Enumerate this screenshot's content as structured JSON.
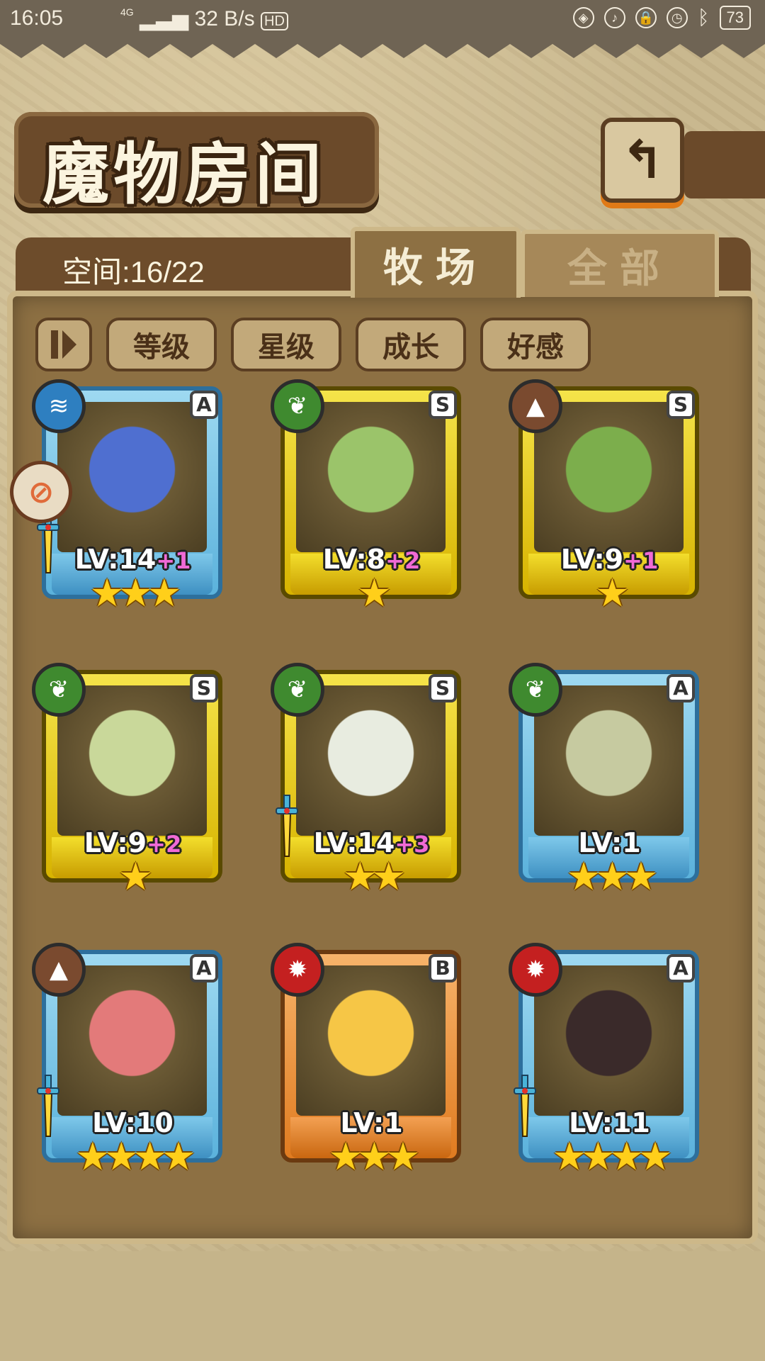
{
  "status_bar": {
    "time": "16:05",
    "network": "4G",
    "speed": "32 B/s",
    "hd": "HD",
    "battery": "73"
  },
  "header": {
    "title": "魔物房间",
    "back_icon": "return-arrow-icon"
  },
  "room": {
    "space_label": "空间:16/22"
  },
  "tabs": [
    {
      "label": "牧场",
      "active": true
    },
    {
      "label": "全部",
      "active": false
    }
  ],
  "sort_buttons": [
    "等级",
    "星级",
    "成长",
    "好感"
  ],
  "monsters": [
    {
      "rank": "A",
      "element": "water",
      "level": "LV:14",
      "bonus": "+1",
      "stars": 3,
      "equipped": true,
      "frame": "A"
    },
    {
      "rank": "S",
      "element": "grass",
      "level": "LV:8",
      "bonus": "+2",
      "stars": 1,
      "equipped": false,
      "frame": "S"
    },
    {
      "rank": "S",
      "element": "earth",
      "level": "LV:9",
      "bonus": "+1",
      "stars": 1,
      "equipped": false,
      "frame": "S"
    },
    {
      "rank": "S",
      "element": "grass",
      "level": "LV:9",
      "bonus": "+2",
      "stars": 1,
      "equipped": false,
      "frame": "S"
    },
    {
      "rank": "S",
      "element": "grass",
      "level": "LV:14",
      "bonus": "+3",
      "stars": 2,
      "equipped": true,
      "frame": "S"
    },
    {
      "rank": "A",
      "element": "grass",
      "level": "LV:1",
      "bonus": "",
      "stars": 3,
      "equipped": false,
      "frame": "A"
    },
    {
      "rank": "A",
      "element": "earth",
      "level": "LV:10",
      "bonus": "",
      "stars": 4,
      "equipped": true,
      "frame": "A"
    },
    {
      "rank": "B",
      "element": "fire",
      "level": "LV:1",
      "bonus": "",
      "stars": 3,
      "equipped": false,
      "frame": "B"
    },
    {
      "rank": "A",
      "element": "fire",
      "level": "LV:11",
      "bonus": "",
      "stars": 4,
      "equipped": true,
      "frame": "A"
    }
  ],
  "element_colors": {
    "water": "#2e7fc0",
    "grass": "#3f8a2f",
    "earth": "#7a4a2f",
    "fire": "#c42020"
  },
  "art_colors": [
    "#4f6fd0",
    "#9bc46a",
    "#7cae4c",
    "#c9d89a",
    "#e8ece0",
    "#c6caa0",
    "#e37a7a",
    "#f6c646",
    "#3a2a2a"
  ]
}
